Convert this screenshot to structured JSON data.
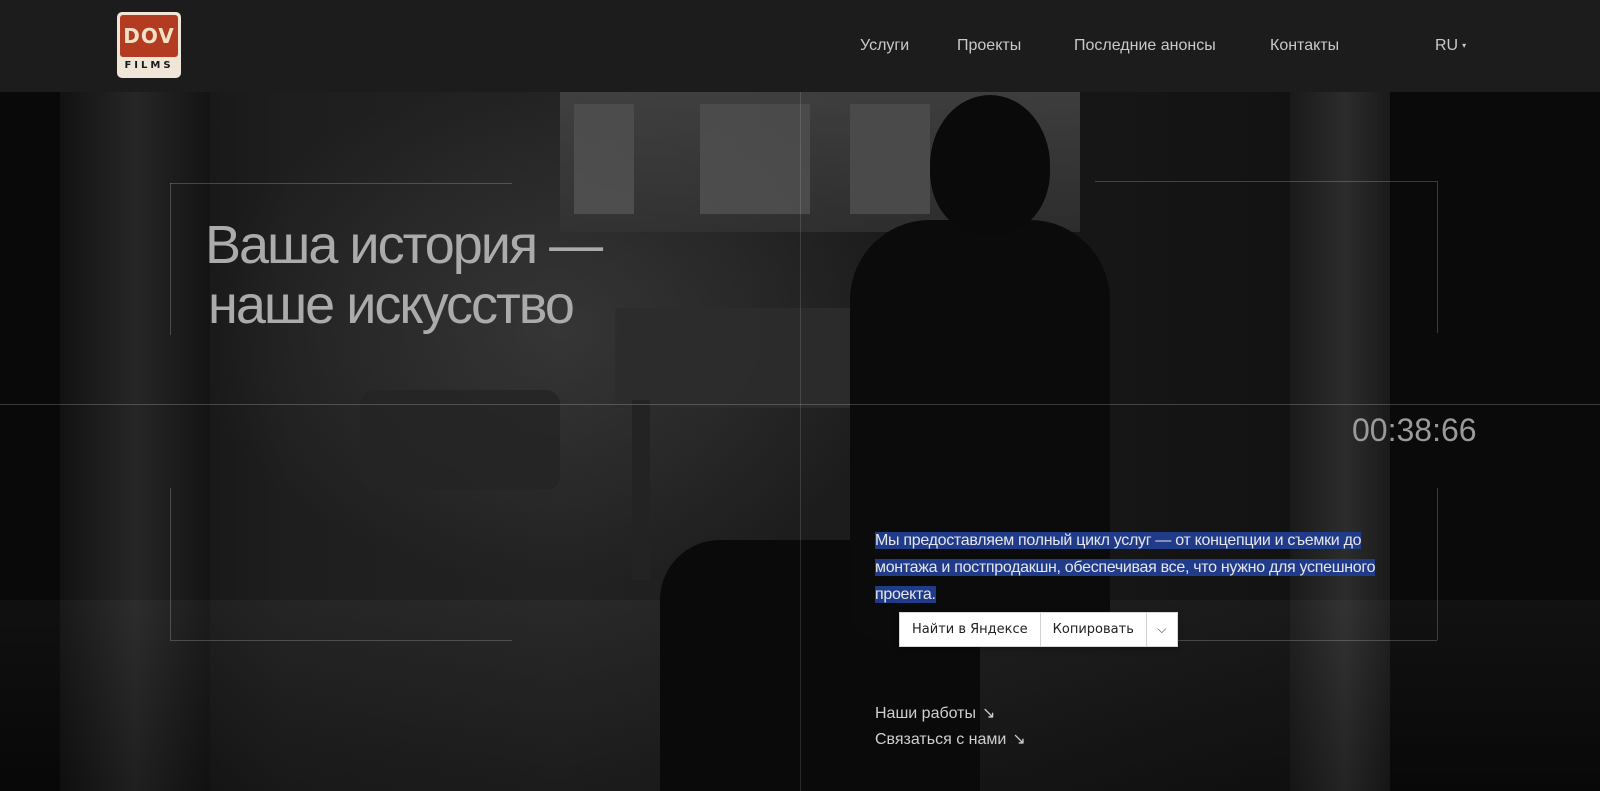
{
  "header": {
    "logo": {
      "line1": "DOV",
      "line2": "FILMS"
    },
    "nav": [
      {
        "label": "Услуги"
      },
      {
        "label": "Проекты"
      },
      {
        "label": "Последние анонсы"
      },
      {
        "label": "Контакты"
      }
    ],
    "language": {
      "label": "RU",
      "caret": "▾"
    }
  },
  "hero": {
    "headline_line1": "Ваша история —",
    "headline_line2": "наше искусство",
    "timer": "00:38:66",
    "description": "Мы предоставляем полный цикл услуг — от концепции и съемки до монтажа и постпродакшн, обеспечивая все, что нужно для успешного проекта.",
    "links": [
      {
        "label": "Наши работы",
        "arrow": "↘"
      },
      {
        "label": "Связаться с нами",
        "arrow": "↘"
      }
    ]
  },
  "context_menu": {
    "search": "Найти в Яндексе",
    "copy": "Копировать",
    "more": "⌵"
  },
  "colors": {
    "header_bg": "#1c1c1c",
    "selection": "#1f3b8a",
    "logo_red": "#b23b22"
  }
}
